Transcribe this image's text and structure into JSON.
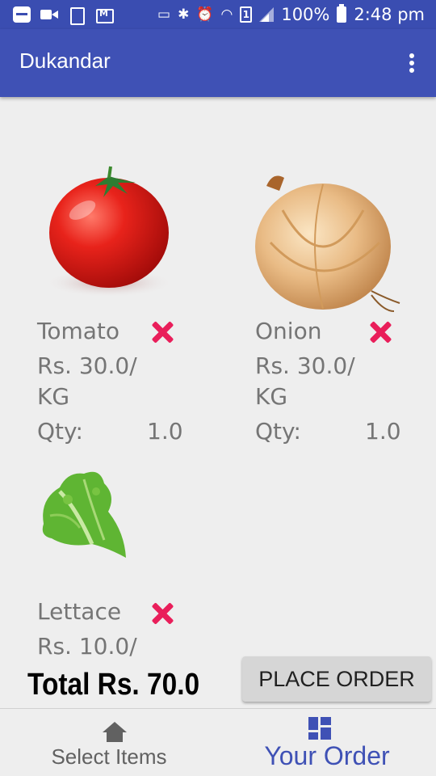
{
  "status_bar": {
    "battery": "100%",
    "time": "2:48 pm",
    "sim": "1"
  },
  "app_bar": {
    "title": "Dukandar"
  },
  "items": [
    {
      "name": "Tomato",
      "price": "Rs. 30.0/ KG",
      "qty_label": "Qty:",
      "qty": "1.0",
      "icon": "tomato"
    },
    {
      "name": "Onion",
      "price": "Rs. 30.0/ KG",
      "qty_label": "Qty:",
      "qty": "1.0",
      "icon": "onion"
    },
    {
      "name": "Lettace",
      "price": "Rs. 10.0/",
      "icon": "lettuce"
    }
  ],
  "total": "Total Rs. 70.0",
  "place_order_label": "PLACE ORDER",
  "bottom_nav": {
    "select_items": "Select Items",
    "your_order": "Your Order",
    "active": "your_order"
  },
  "colors": {
    "primary": "#3f51b5",
    "status_bar": "#3a4db1",
    "remove": "#e91e5a"
  }
}
